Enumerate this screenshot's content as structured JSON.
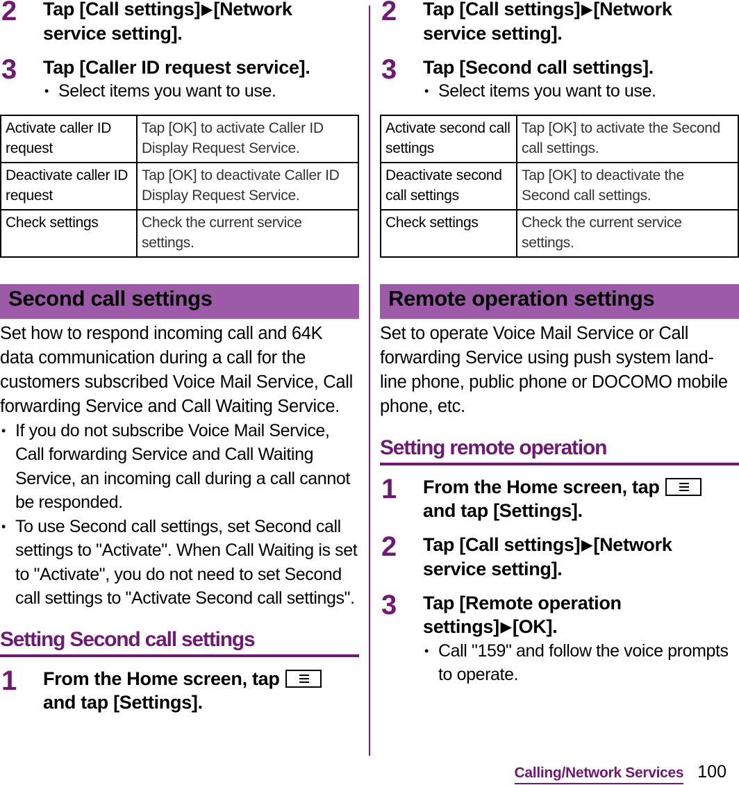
{
  "left": {
    "steps_top": [
      {
        "num": "2",
        "text_a": "Tap [Call settings]",
        "text_b": "[Network service setting]."
      },
      {
        "num": "3",
        "text": "Tap [Caller ID request service].",
        "bullet": "Select items you want to use."
      }
    ],
    "table": [
      {
        "key": "Activate caller ID request",
        "value": "Tap [OK] to activate Caller ID Display Request Service."
      },
      {
        "key": "Deactivate caller ID request",
        "value": "Tap [OK] to deactivate Caller ID Display Request Service."
      },
      {
        "key": "Check settings",
        "value": "Check the current service settings."
      }
    ],
    "section_title": "Second call settings",
    "intro": "Set how to respond incoming call and 64K data communication during a call for the customers subscribed Voice Mail Service, Call forwarding Service and Call Waiting Service.",
    "bullets": [
      "If you do not subscribe Voice Mail Service, Call forwarding Service and Call Waiting Service, an incoming call during a call cannot be responded.",
      "To use Second call settings, set Second call settings to \"Activate\". When Call Waiting is set to \"Activate\", you do not need to set Second call settings to \"Activate Second call settings\"."
    ],
    "subheading": "Setting Second call settings",
    "step1": {
      "num": "1",
      "text_a": "From the Home screen, tap",
      "text_b": "and tap [Settings]."
    }
  },
  "right": {
    "steps_top": [
      {
        "num": "2",
        "text_a": "Tap [Call settings]",
        "text_b": "[Network service setting]."
      },
      {
        "num": "3",
        "text": "Tap [Second call settings].",
        "bullet": "Select items you want to use."
      }
    ],
    "table": [
      {
        "key": "Activate second call settings",
        "value": "Tap [OK] to activate the Second call settings."
      },
      {
        "key": "Deactivate second call settings",
        "value": "Tap [OK] to deactivate the Second call settings."
      },
      {
        "key": "Check settings",
        "value": "Check the current service settings."
      }
    ],
    "section_title": "Remote operation settings",
    "intro": "Set to operate Voice Mail Service or Call forwarding Service using push system land-line phone, public phone or DOCOMO mobile phone, etc.",
    "subheading": "Setting remote operation",
    "steps": [
      {
        "num": "1",
        "text_a": "From the Home screen, tap",
        "text_b": "and tap [Settings]."
      },
      {
        "num": "2",
        "text_a": "Tap [Call settings]",
        "text_b": "[Network service setting]."
      },
      {
        "num": "3",
        "text_a": "Tap [Remote operation settings]",
        "text_b": "[OK].",
        "bullet": "Call \"159\" and follow the voice prompts to operate."
      }
    ]
  },
  "icons": {
    "arrow": "▶",
    "menu_key": "menu-key-icon"
  },
  "footer": {
    "section": "Calling/Network Services",
    "page": "100"
  },
  "colors": {
    "accent": "#6e1a75",
    "banner": "#9c5aa8"
  }
}
